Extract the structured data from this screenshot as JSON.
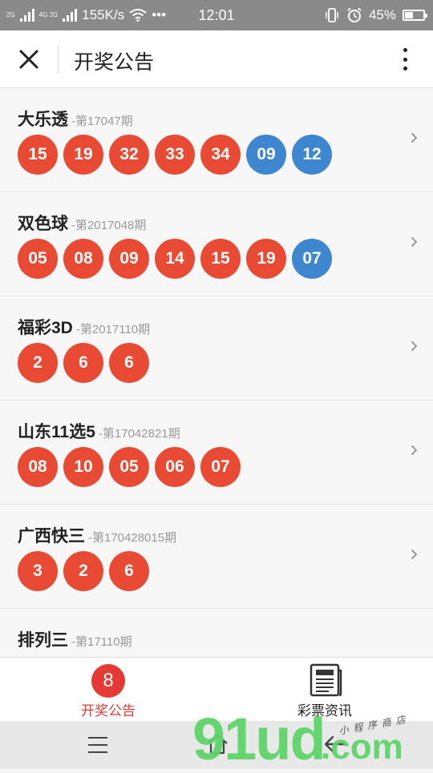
{
  "status": {
    "net_type_top": "2G",
    "net_type_bottom": "4G 2G",
    "speed": "155K/s",
    "dots": "•••",
    "time": "12:01",
    "battery": "45%",
    "battery_level": 0.45
  },
  "header": {
    "title": "开奖公告"
  },
  "lotteries": [
    {
      "name": "大乐透",
      "issue": "-第17047期",
      "balls": [
        {
          "n": "15",
          "c": "red"
        },
        {
          "n": "19",
          "c": "red"
        },
        {
          "n": "32",
          "c": "red"
        },
        {
          "n": "33",
          "c": "red"
        },
        {
          "n": "34",
          "c": "red"
        },
        {
          "n": "09",
          "c": "blue"
        },
        {
          "n": "12",
          "c": "blue"
        }
      ]
    },
    {
      "name": "双色球",
      "issue": "-第2017048期",
      "balls": [
        {
          "n": "05",
          "c": "red"
        },
        {
          "n": "08",
          "c": "red"
        },
        {
          "n": "09",
          "c": "red"
        },
        {
          "n": "14",
          "c": "red"
        },
        {
          "n": "15",
          "c": "red"
        },
        {
          "n": "19",
          "c": "red"
        },
        {
          "n": "07",
          "c": "blue"
        }
      ]
    },
    {
      "name": "福彩3D",
      "issue": "-第2017110期",
      "balls": [
        {
          "n": "2",
          "c": "red"
        },
        {
          "n": "6",
          "c": "red"
        },
        {
          "n": "6",
          "c": "red"
        }
      ]
    },
    {
      "name": "山东11选5",
      "issue": "-第17042821期",
      "balls": [
        {
          "n": "08",
          "c": "red"
        },
        {
          "n": "10",
          "c": "red"
        },
        {
          "n": "05",
          "c": "red"
        },
        {
          "n": "06",
          "c": "red"
        },
        {
          "n": "07",
          "c": "red"
        }
      ]
    },
    {
      "name": "广西快三",
      "issue": "-第170428015期",
      "balls": [
        {
          "n": "3",
          "c": "red"
        },
        {
          "n": "2",
          "c": "red"
        },
        {
          "n": "6",
          "c": "red"
        }
      ]
    },
    {
      "name": "排列三",
      "issue": "-第17110期",
      "balls": []
    }
  ],
  "tabs": {
    "announce_badge": "8",
    "announce_label": "开奖公告",
    "news_label": "彩票资讯"
  },
  "watermark": {
    "main": "91ud",
    "com": ".com",
    "sub": "小程序商店"
  },
  "colors": {
    "ball_red": "#e84a34",
    "ball_blue": "#3e87d0",
    "accent": "#e53935"
  }
}
